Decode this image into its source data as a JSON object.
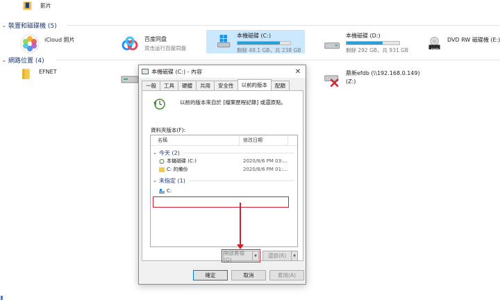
{
  "explorer": {
    "videos_label": "影片",
    "devices_header": "裝置和磁碟機 (5)",
    "network_header": "網路位置 (4)",
    "devices": [
      {
        "name": "iCloud 照片",
        "sub": ""
      },
      {
        "name": "百度同盘",
        "sub": "双击运行百度同盘"
      },
      {
        "name": "本機磁碟 (C:)",
        "sub": "剩餘 48.1 GB，共 238 GB",
        "used_fraction": 0.8
      },
      {
        "name": "本機磁碟 (D:)",
        "sub": "剩餘 292 GB，共 931 GB",
        "used_fraction": 0.69
      },
      {
        "name": "DVD RW 磁碟機 (E:)",
        "sub": ""
      }
    ],
    "network": [
      {
        "name": "EFNET"
      },
      {
        "name": "鼎新efdb (\\\\192.168.0.149)",
        "sub": "(Z:)"
      }
    ],
    "dvd_badge": "DVD"
  },
  "dialog": {
    "title": "本機磁碟 (C:) - 內容",
    "close": "✕",
    "tabs": [
      "一般",
      "工具",
      "硬體",
      "共用",
      "安全性",
      "以前的版本",
      "配額"
    ],
    "active_tab": 5,
    "description": "以前的版本來自於 [檔案歷程記錄] 或還原點。",
    "folder_versions_label": "資料夾版本(F):",
    "columns": {
      "name": "名稱",
      "date": "修改日期"
    },
    "groups": [
      {
        "label": "今天 (2)",
        "rows": [
          {
            "name": "本機磁碟 (C:)",
            "date": "2020/8/6 PM 03:..."
          },
          {
            "name": "C: 的備份",
            "date": "2020/8/6 PM 01:..."
          }
        ]
      },
      {
        "label": "未指定 (1)",
        "rows": [
          {
            "name": "C:",
            "date": ""
          }
        ]
      }
    ],
    "open_button": "開啟舊檔(O)",
    "restore_button": "還原(R)",
    "ok_button": "確定",
    "cancel_button": "取消",
    "apply_button": "套用(A)"
  },
  "colors": {
    "annotation_red": "#d11f2b",
    "selection_blue": "#cce8ff",
    "bar_blue": "#26a0da"
  }
}
